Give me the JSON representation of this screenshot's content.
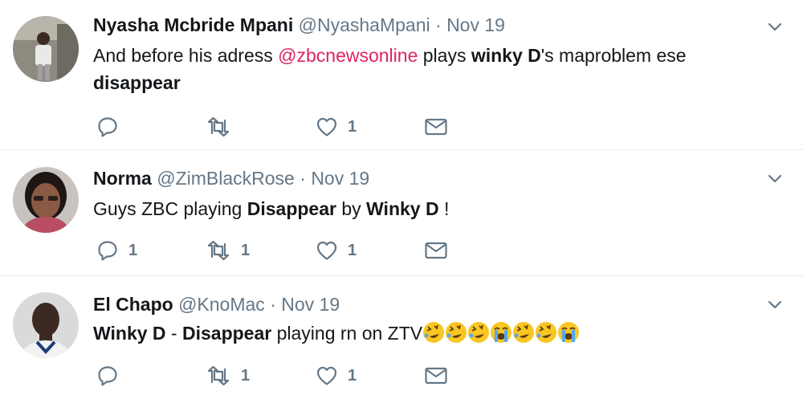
{
  "tweets": [
    {
      "name": "Nyasha Mcbride Mpani",
      "handle": "@NyashaMpani",
      "dot": "·",
      "time": "Nov 19",
      "text_parts": {
        "a": "And before his adress ",
        "mention": "@zbcnewsonline",
        "b": " plays ",
        "bold1": "winky D",
        "c": "'s maproblem ese",
        "bold2": "disappear"
      },
      "reply_count": "",
      "retweet_count": "",
      "like_count": "1"
    },
    {
      "name": "Norma",
      "handle": "@ZimBlackRose",
      "dot": "·",
      "time": "Nov 19",
      "text_parts": {
        "a": "Guys ZBC playing ",
        "bold1": "Disappear",
        "b": " by ",
        "bold2": "Winky D",
        "c": " !"
      },
      "reply_count": "1",
      "retweet_count": "1",
      "like_count": "1"
    },
    {
      "name": "El Chapo",
      "handle": "@KnoMac",
      "dot": "·",
      "time": "Nov 19",
      "text_parts": {
        "bold1": "Winky D",
        "a": " - ",
        "bold2": "Disappear",
        "b": " playing rn on ZTV"
      },
      "emojis": [
        "rolling-on-the-floor-laughing",
        "rolling-on-the-floor-laughing",
        "rolling-on-the-floor-laughing",
        "loudly-crying-face",
        "rolling-on-the-floor-laughing",
        "rolling-on-the-floor-laughing",
        "loudly-crying-face"
      ],
      "reply_count": "",
      "retweet_count": "1",
      "like_count": "1"
    }
  ],
  "colors": {
    "text": "#14171a",
    "secondary": "#657786",
    "mention": "#e0245e",
    "divider": "#e6ecf0"
  }
}
